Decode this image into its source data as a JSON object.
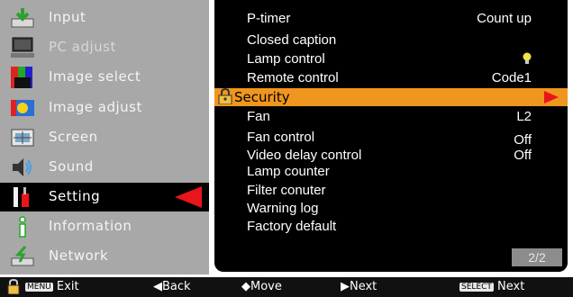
{
  "left_menu": {
    "items": [
      {
        "label": "Input",
        "icon": "input-icon",
        "state": "normal"
      },
      {
        "label": "PC adjust",
        "icon": "pc-adjust-icon",
        "state": "dim"
      },
      {
        "label": "Image select",
        "icon": "image-select-icon",
        "state": "normal"
      },
      {
        "label": "Image adjust",
        "icon": "image-adjust-icon",
        "state": "normal"
      },
      {
        "label": "Screen",
        "icon": "screen-icon",
        "state": "normal"
      },
      {
        "label": "Sound",
        "icon": "sound-icon",
        "state": "normal"
      },
      {
        "label": "Setting",
        "icon": "setting-icon",
        "state": "selected"
      },
      {
        "label": "Information",
        "icon": "information-icon",
        "state": "normal"
      },
      {
        "label": "Network",
        "icon": "network-icon",
        "state": "normal"
      }
    ]
  },
  "settings_panel": {
    "rows": [
      {
        "label": "P-timer",
        "value": "Count up"
      },
      {
        "label": "Closed caption",
        "value": ""
      },
      {
        "label": "Lamp control",
        "value": "lamp-bulb-icon"
      },
      {
        "label": "Remote control",
        "value": "Code1"
      },
      {
        "label": "Security",
        "value": "",
        "highlighted": true
      },
      {
        "label": "Fan",
        "value": "L2"
      },
      {
        "label": "Fan control",
        "value": "Off"
      },
      {
        "label": "Video delay control",
        "value": "Off"
      },
      {
        "label": "Lamp counter",
        "value": ""
      },
      {
        "label": "Filter conuter",
        "value": ""
      },
      {
        "label": "Warning log",
        "value": ""
      },
      {
        "label": "Factory default",
        "value": ""
      }
    ],
    "page_indicator": "2/2"
  },
  "bottom_bar": {
    "menu_key": "MENU",
    "exit_label": "Exit",
    "back_label": "◀Back",
    "move_label": "◆Move",
    "next_label": "▶Next",
    "select_key": "SELECT",
    "select_next_label": "Next"
  },
  "colors": {
    "highlight": "#f0961e",
    "arrow": "#e8151c",
    "menu_bg": "#a8a8a8",
    "panel_bg": "#000000"
  }
}
